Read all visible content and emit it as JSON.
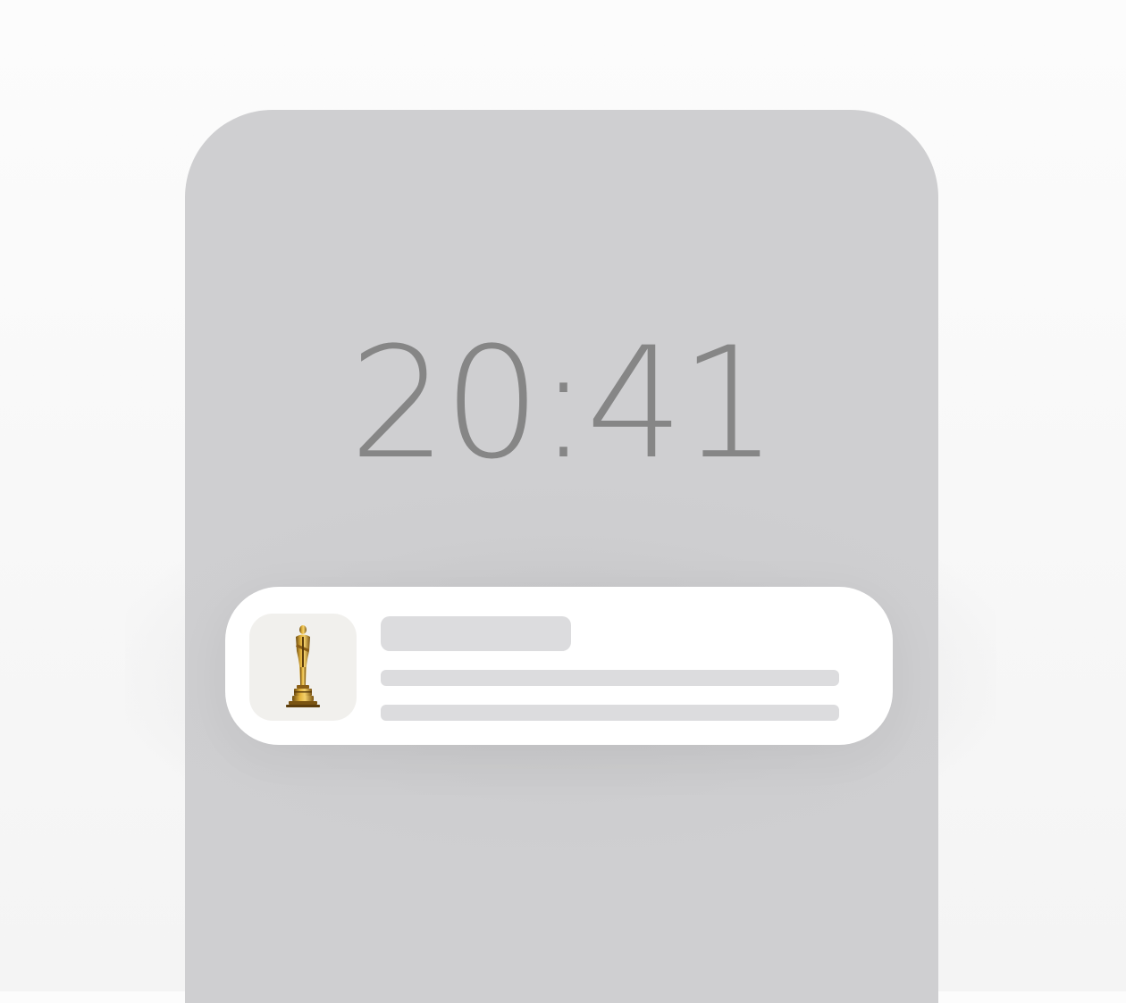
{
  "lockscreen": {
    "time": "20:41"
  },
  "notification": {
    "icon": "oscar-statuette-icon"
  },
  "colors": {
    "background": "#f8f8f8",
    "phone": "#cfcfd1",
    "clock": "#868686",
    "card": "#ffffff",
    "placeholder": "#dcdcde",
    "icon_tile": "#f1f0ed",
    "statuette_gold": "#c8962a"
  }
}
